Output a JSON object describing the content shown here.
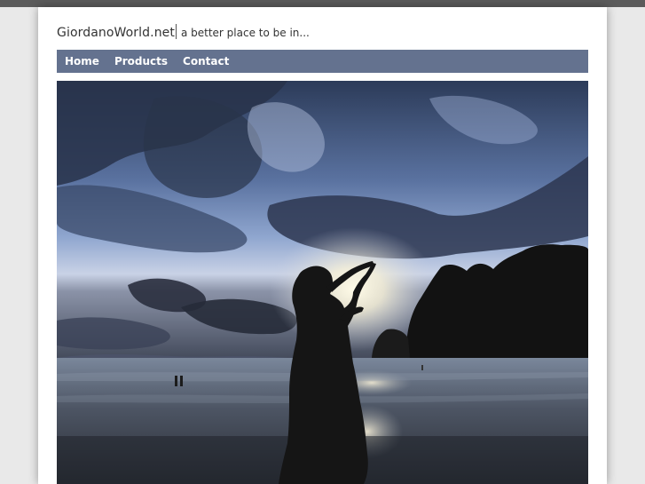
{
  "header": {
    "site_name": "GiordanoWorld.net",
    "tagline": "a better place to be in..."
  },
  "nav": {
    "items": [
      {
        "label": "Home"
      },
      {
        "label": "Products"
      },
      {
        "label": "Contact"
      }
    ]
  },
  "hero": {
    "colors": {
      "sky_top": "#2f3f5e",
      "sky_mid": "#7f97c4",
      "sun": "#fff6d8",
      "cliff": "#141414",
      "sea": "#6e7a8a"
    }
  }
}
